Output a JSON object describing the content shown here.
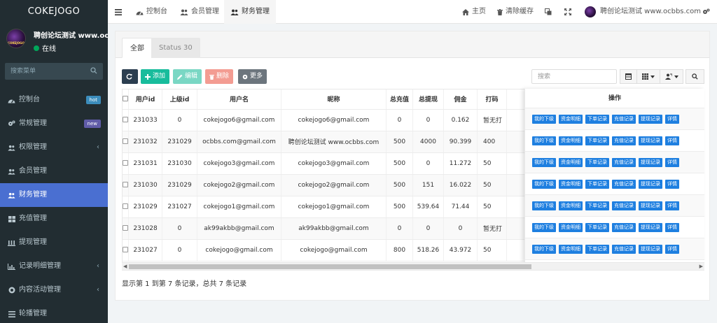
{
  "brand": {
    "title": "COKEJOGO"
  },
  "user": {
    "name": "聘创论坛测试 www.ocbbs.com",
    "status": "在线",
    "avatar_text": "COKEJOGO"
  },
  "sidebar": {
    "search_placeholder": "搜索菜单",
    "items": [
      {
        "label": "控制台",
        "icon": "dashboard-icon",
        "badge": "hot"
      },
      {
        "label": "常规管理",
        "icon": "cogs-icon",
        "badge": "new"
      },
      {
        "label": "权限管理",
        "icon": "group-icon",
        "chevron": true
      },
      {
        "label": "会员管理",
        "icon": "user-icon"
      },
      {
        "label": "财务管理",
        "icon": "user-icon",
        "active": true
      },
      {
        "label": "充值管理",
        "icon": "grid-icon"
      },
      {
        "label": "提现管理",
        "icon": "bank-icon"
      },
      {
        "label": "记录明细管理",
        "icon": "bar-chart-icon",
        "chevron": true
      },
      {
        "label": "内容活动管理",
        "icon": "circle-icon",
        "chevron": true
      },
      {
        "label": "轮播管理",
        "icon": "list-icon"
      }
    ]
  },
  "topbar": {
    "tabs": [
      "控制台",
      "会员管理",
      "财务管理"
    ],
    "home": "主页",
    "clear_cache": "清除缓存",
    "username": "聘创论坛测试 www.ocbbs.com"
  },
  "panel": {
    "tabs": [
      "全部",
      "Status 30"
    ],
    "buttons": {
      "add": "添加",
      "edit": "编辑",
      "delete": "删除",
      "more": "更多"
    },
    "search_placeholder": "搜索",
    "columns": [
      "用户id",
      "上级id",
      "用户名",
      "昵称",
      "总充值",
      "总提现",
      "佣金",
      "打码"
    ],
    "ops_header": "操作",
    "op_buttons": [
      "我的下级",
      "资金明细",
      "下单记录",
      "充值记录",
      "提现记录",
      "详情"
    ],
    "rows": [
      [
        "231033",
        "0",
        "cokejogo6@gmail.com",
        "cokejogo6@gmail.com",
        "0",
        "0",
        "0.162",
        "暂无打"
      ],
      [
        "231032",
        "231029",
        "ocbbs.com@gmail.com",
        "聘创论坛测试 www.ocbbs.com",
        "500",
        "4000",
        "90.399",
        "400"
      ],
      [
        "231031",
        "231030",
        "cokejogo3@gmail.com",
        "cokejogo3@gmail.com",
        "500",
        "0",
        "11.272",
        "50"
      ],
      [
        "231030",
        "231029",
        "cokejogo2@gmail.com",
        "cokejogo2@gmail.com",
        "500",
        "151",
        "16.022",
        "50"
      ],
      [
        "231029",
        "231027",
        "cokejogo1@gmail.com",
        "cokejogo1@gmail.com",
        "500",
        "539.64",
        "71.44",
        "50"
      ],
      [
        "231028",
        "0",
        "ak99akbb@gmail.com",
        "ak99akbb@gmail.com",
        "0",
        "0",
        "0",
        "暂无打"
      ],
      [
        "231027",
        "0",
        "cokejogo@gmail.com",
        "cokejogo@gmail.com",
        "800",
        "518.26",
        "43.972",
        "50"
      ]
    ],
    "footer": "显示第 1 到第 7 条记录，总共 7 条记录"
  },
  "colors": {
    "sidebar_bg": "#222d32",
    "active": "#4a6fd1",
    "add": "#18bc9c",
    "edit": "#7ad7c4",
    "delete": "#f39c92",
    "more": "#6c757d",
    "refresh": "#2c3e50",
    "op": "#1e7fe0"
  }
}
